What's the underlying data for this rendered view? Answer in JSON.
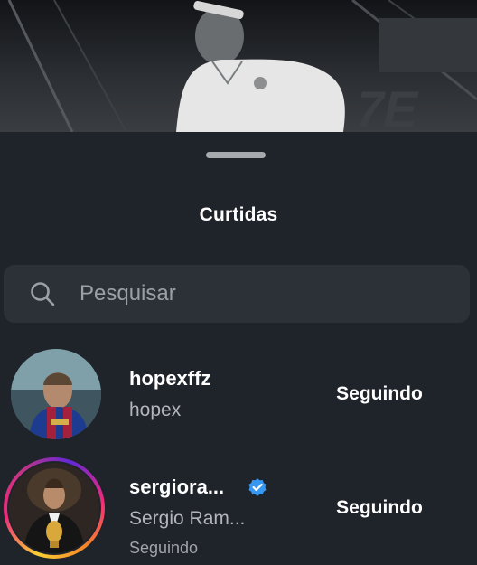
{
  "sheet": {
    "title": "Curtidas"
  },
  "search": {
    "placeholder": "Pesquisar",
    "icon": "search-icon"
  },
  "users": [
    {
      "username": "hopexffz",
      "full_name": "hopex",
      "button_label": "Seguindo",
      "verified": false,
      "has_story": false
    },
    {
      "username": "sergiora...",
      "full_name": "Sergio Ram...",
      "status": "Seguindo",
      "button_label": "Seguindo",
      "verified": true,
      "has_story": true
    }
  ],
  "colors": {
    "sheet_bg": "#1f232a",
    "search_bg": "#2c3138",
    "verified_blue": "#3897f0",
    "secondary_text": "#b3b7bc"
  }
}
